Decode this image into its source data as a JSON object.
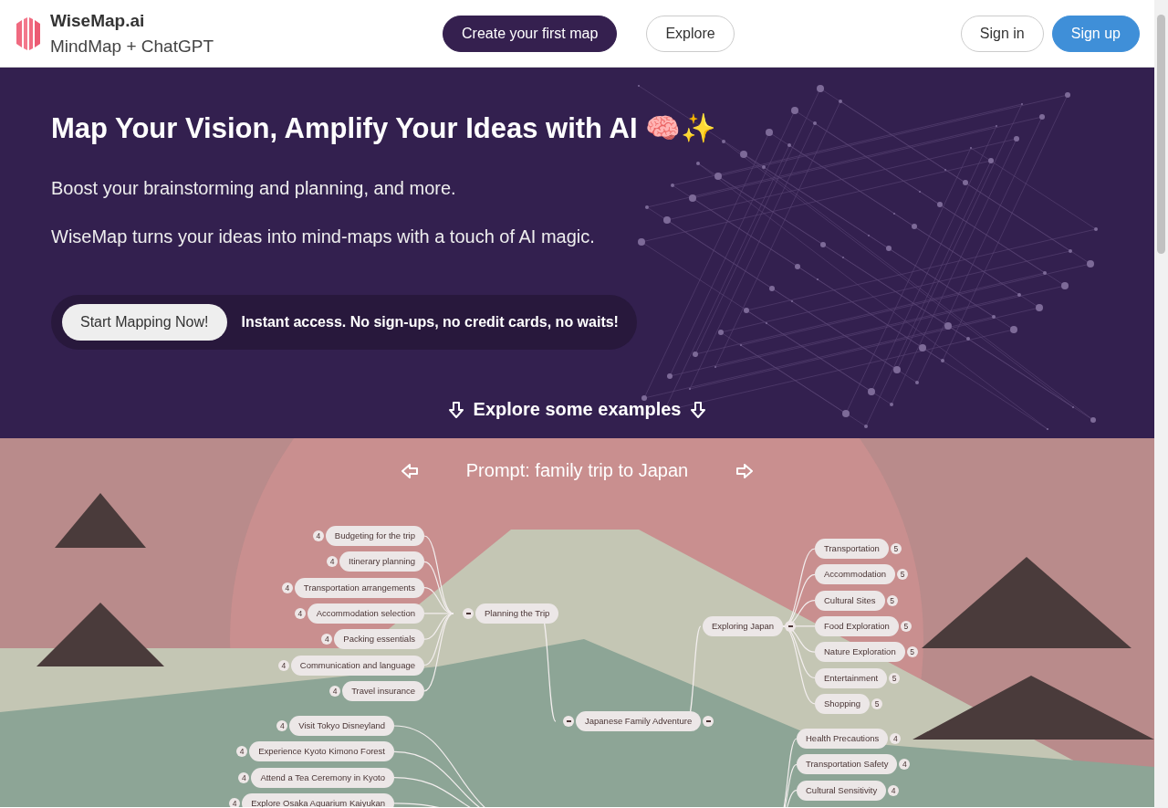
{
  "header": {
    "brand": "WiseMap.ai",
    "tagline": "MindMap + ChatGPT",
    "nav": [
      {
        "label": "Create your first map",
        "kind": "primary"
      },
      {
        "label": "Explore",
        "kind": "outline"
      }
    ],
    "auth": [
      {
        "label": "Sign in",
        "kind": "outline"
      },
      {
        "label": "Sign up",
        "kind": "blue"
      }
    ]
  },
  "hero": {
    "title": "Map Your Vision, Amplify Your Ideas with AI 🧠✨",
    "lines": [
      "Boost your brainstorming and planning, and more.",
      "WiseMap turns your ideas into mind-maps with a touch of AI magic."
    ],
    "cta": "Start Mapping Now!",
    "cta_note": "Instant access. No sign-ups, no credit cards, no waits!",
    "examples_link": "Explore some examples"
  },
  "example": {
    "prompt": "Prompt: family trip to Japan",
    "mindmap": {
      "root": "Japanese Family Adventure",
      "branches": [
        {
          "kind": "left",
          "label": "Planning the Trip",
          "children": [
            {
              "label": "Budgeting for the trip",
              "count": "4"
            },
            {
              "label": "Itinerary planning",
              "count": "4"
            },
            {
              "label": "Transportation arrangements",
              "count": "4"
            },
            {
              "label": "Accommodation selection",
              "count": "4"
            },
            {
              "label": "Packing essentials",
              "count": "4"
            },
            {
              "label": "Communication and language",
              "count": "4"
            },
            {
              "label": "Travel insurance",
              "count": "4"
            }
          ]
        },
        {
          "kind": "left",
          "children": [
            {
              "label": "Visit Tokyo Disneyland",
              "count": "4"
            },
            {
              "label": "Experience Kyoto Kimono Forest",
              "count": "4"
            },
            {
              "label": "Attend a Tea Ceremony in Kyoto",
              "count": "4"
            },
            {
              "label": "Explore Osaka Aquarium Kaiyukan",
              "count": "4"
            }
          ]
        },
        {
          "kind": "right",
          "label": "Exploring Japan",
          "children": [
            {
              "label": "Transportation",
              "count": "5"
            },
            {
              "label": "Accommodation",
              "count": "5"
            },
            {
              "label": "Cultural Sites",
              "count": "5"
            },
            {
              "label": "Food Exploration",
              "count": "5"
            },
            {
              "label": "Nature Exploration",
              "count": "5"
            },
            {
              "label": "Entertainment",
              "count": "5"
            },
            {
              "label": "Shopping",
              "count": "5"
            }
          ]
        },
        {
          "kind": "right",
          "children": [
            {
              "label": "Health Precautions",
              "count": "4"
            },
            {
              "label": "Transportation Safety",
              "count": "4"
            },
            {
              "label": "Cultural Sensitivity",
              "count": "4"
            }
          ]
        }
      ]
    }
  }
}
